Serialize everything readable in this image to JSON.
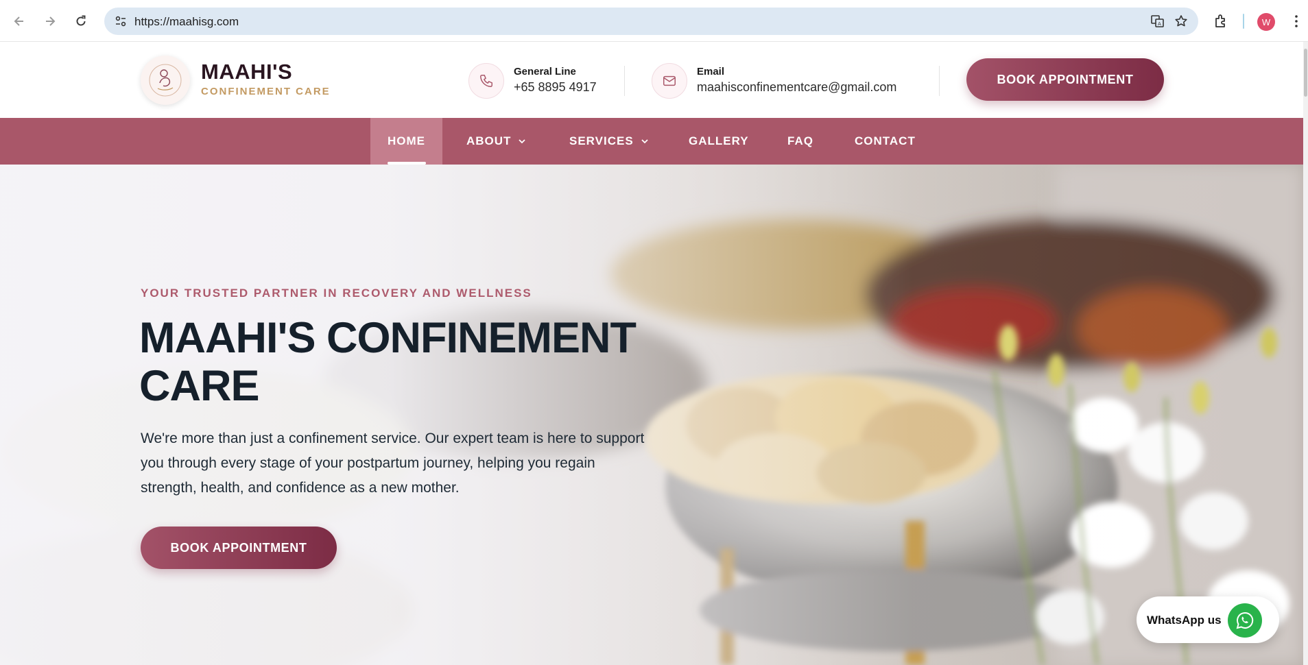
{
  "browser": {
    "url": "https://maahisg.com",
    "profile_initial": "W",
    "icons": [
      "back-arrow-icon",
      "forward-arrow-icon",
      "reload-icon",
      "site-settings-icon",
      "translate-icon",
      "star-icon",
      "extensions-icon",
      "kebab-menu-icon"
    ]
  },
  "header": {
    "brand_name": "MAAHI'S",
    "brand_tagline": "CONFINEMENT CARE",
    "phone_label": "General Line",
    "phone_value": "+65 8895 4917",
    "email_label": "Email",
    "email_value": "maahisconfinementcare@gmail.com",
    "book_label": "BOOK APPOINTMENT"
  },
  "nav": {
    "items": [
      {
        "label": "HOME",
        "active": true
      },
      {
        "label": "ABOUT",
        "dropdown": true
      },
      {
        "label": "SERVICES",
        "dropdown": true
      },
      {
        "label": "GALLERY"
      },
      {
        "label": "FAQ"
      },
      {
        "label": "CONTACT"
      }
    ]
  },
  "hero": {
    "eyebrow": "YOUR TRUSTED PARTNER IN RECOVERY AND WELLNESS",
    "title_line1": "MAAHI'S CONFINEMENT",
    "title_line2": "CARE",
    "description": "We're more than just a confinement service. Our expert team is here to support you through every stage of your postpartum journey, helping you regain strength, health, and confidence as a new mother.",
    "book_label": "BOOK APPOINTMENT"
  },
  "whatsapp": {
    "label": "WhatsApp us"
  },
  "colors": {
    "brand": "#a95769",
    "brand_dark": "#7c2c45",
    "gold": "#c39a62",
    "whatsapp": "#29b34b"
  }
}
